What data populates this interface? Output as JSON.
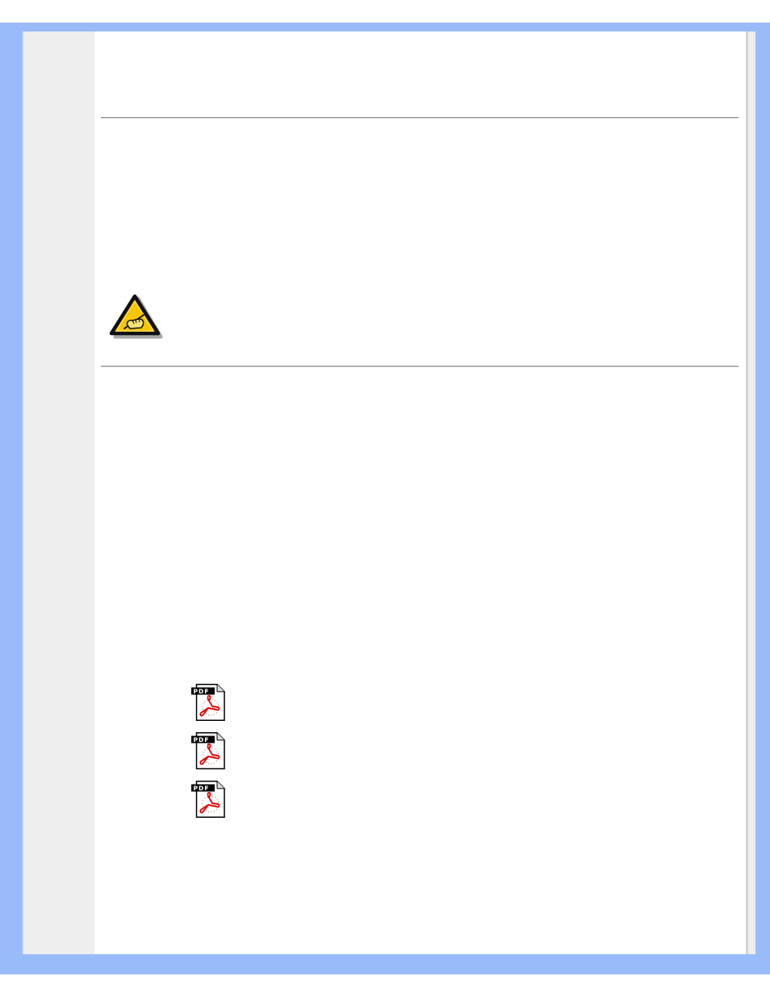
{
  "downloads": [
    {
      "label": "PDF"
    },
    {
      "label": "PDF"
    },
    {
      "label": "PDF"
    }
  ]
}
